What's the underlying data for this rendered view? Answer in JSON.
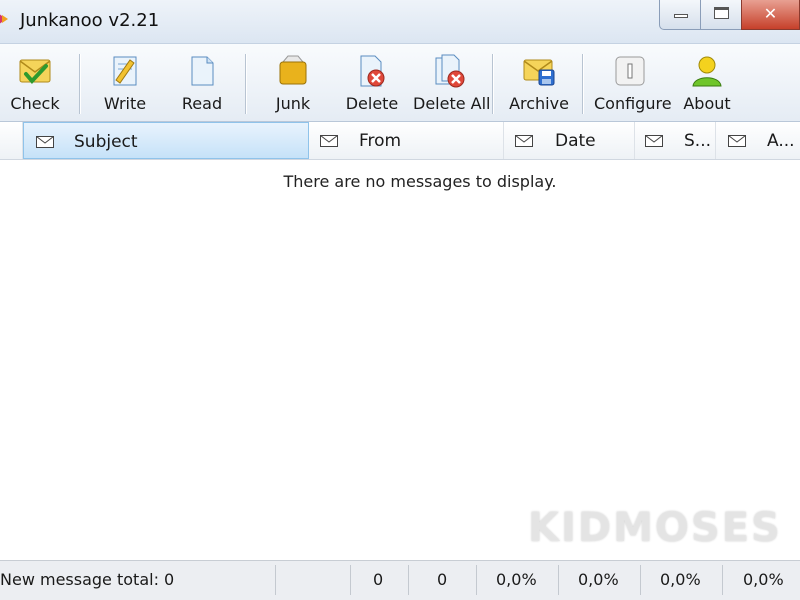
{
  "window": {
    "title": "Junkanoo v2.21",
    "controls": {
      "minimize": "minimize",
      "maximize": "maximize",
      "close": "✕"
    }
  },
  "toolbar": {
    "buttons": [
      {
        "label": "Check",
        "icon": "check-mail-icon"
      },
      {
        "label": "Write",
        "icon": "write-icon"
      },
      {
        "label": "Read",
        "icon": "read-icon"
      },
      {
        "label": "Junk",
        "icon": "junk-icon"
      },
      {
        "label": "Delete",
        "icon": "delete-icon"
      },
      {
        "label": "Delete All",
        "icon": "delete-all-icon"
      },
      {
        "label": "Archive",
        "icon": "archive-icon"
      },
      {
        "label": "Configure",
        "icon": "configure-icon"
      },
      {
        "label": "About",
        "icon": "about-icon"
      }
    ]
  },
  "columns": [
    {
      "label": "Subject",
      "icon": "envelope-icon"
    },
    {
      "label": "From",
      "icon": "envelope-icon"
    },
    {
      "label": "Date",
      "icon": "envelope-icon"
    },
    {
      "label": "S...",
      "icon": "envelope-icon"
    },
    {
      "label": "A...",
      "icon": "envelope-icon"
    }
  ],
  "message_list": {
    "empty_text": "There are no messages to display."
  },
  "watermark": "KIDMOSES",
  "statusbar": {
    "total": "New message total: 0",
    "count1": "0",
    "count2": "0",
    "pct1": "0,0%",
    "pct2": "0,0%",
    "pct3": "0,0%",
    "pct4": "0,0%"
  },
  "colors": {
    "accent": "#c6e2f8",
    "close_button": "#c6402a",
    "titlebar": "#dce6f2"
  }
}
